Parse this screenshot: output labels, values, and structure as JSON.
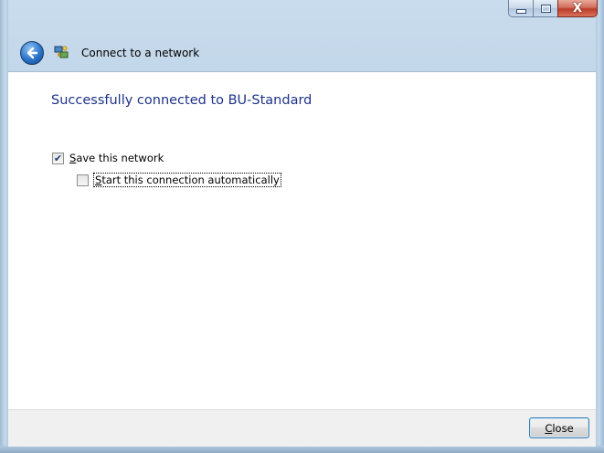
{
  "window": {
    "caption_buttons": {
      "minimize_icon": "minimize-icon",
      "maximize_icon": "maximize-icon",
      "close_glyph": "X"
    }
  },
  "navbar": {
    "back_icon": "back-arrow-icon",
    "network_icon": "network-connection-icon",
    "title": "Connect to a network"
  },
  "content": {
    "heading": "Successfully connected to BU-Standard",
    "save_network": {
      "label_accel": "S",
      "label_rest": "ave this network",
      "checked": true
    },
    "start_auto": {
      "label_accel": "S",
      "label_rest": "tart this connection automatically",
      "checked": false
    }
  },
  "footer": {
    "close_accel": "C",
    "close_rest": "lose"
  },
  "colors": {
    "heading": "#1e3287",
    "close_button_border": "#3c7fb1",
    "caption_close": "#c24a36"
  }
}
